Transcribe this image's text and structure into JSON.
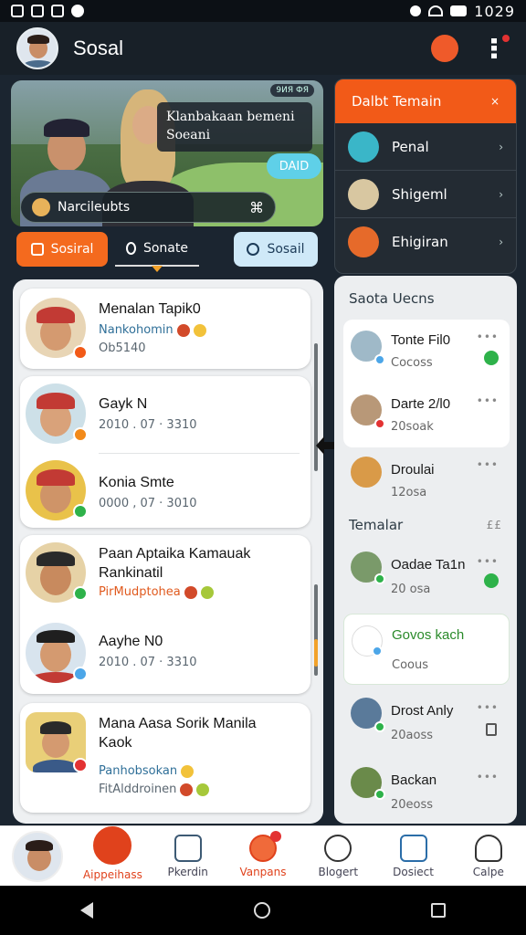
{
  "statusbar": {
    "time": "1029"
  },
  "appbar": {
    "title": "Sosal"
  },
  "hero": {
    "tag": "9ИЯ ФЯ",
    "bubble_line1": "Klanbakaan bemeni",
    "bubble_line2": "Soeani",
    "chip": "DAID",
    "bar_text": "Narcileubts"
  },
  "tabs": [
    {
      "label": "Sosiral"
    },
    {
      "label": "Sonate"
    },
    {
      "label": "Sosail"
    }
  ],
  "menu": {
    "header": "Dalbt Temain",
    "close": "×",
    "items": [
      {
        "label": "Penal"
      },
      {
        "label": "Shigeml"
      },
      {
        "label": "Ehigiran"
      }
    ]
  },
  "feed": [
    {
      "name": "Menalan Tapik0",
      "sub1": "Nankohomin",
      "sub2": "Ob5140"
    },
    {
      "name": "Gayk N",
      "sub1": "2010 . 07 · 3310"
    },
    {
      "name": "Konia Smte",
      "sub1": "0000 , 07 · 3010"
    },
    {
      "name": "Paan Aptaika Kamauak",
      "name2": "Rankinatil",
      "sub1": "PirMudptohea"
    },
    {
      "name": "Aayhe N0",
      "sub1": "2010 . 07 · 3310"
    },
    {
      "name": "Mana Aasa Sorik Manila",
      "name2": "Kaok",
      "sub1": "Panhobsokan",
      "sub2": "FitAlddroinen"
    }
  ],
  "side": {
    "section1": "Saota Uecns",
    "section2": "Temalar",
    "section2_icon": "££",
    "items": [
      {
        "name": "Tonte Fil0",
        "sub": "Cocoss"
      },
      {
        "name": "Darte 2/l0",
        "sub": "20soak"
      },
      {
        "name": "Droulai",
        "sub": "12osa"
      },
      {
        "name": "Oadae Ta1n",
        "sub": "20 osa"
      },
      {
        "name": "Govos kach",
        "sub": "Coous"
      },
      {
        "name": "Drost Anly",
        "sub": "20aoss"
      },
      {
        "name": "Backan",
        "sub": "20eoss"
      }
    ],
    "more": "•••"
  },
  "bottomnav": [
    {
      "label": ""
    },
    {
      "label": "Aippeihass"
    },
    {
      "label": "Pkerdin"
    },
    {
      "label": "Vanpans"
    },
    {
      "label": "Blogert"
    },
    {
      "label": "Dosiect"
    },
    {
      "label": "Calpe"
    }
  ],
  "colors": {
    "accent": "#f25a18",
    "dark": "#182028",
    "panel": "#eef0f2",
    "success": "#2eb24a"
  }
}
